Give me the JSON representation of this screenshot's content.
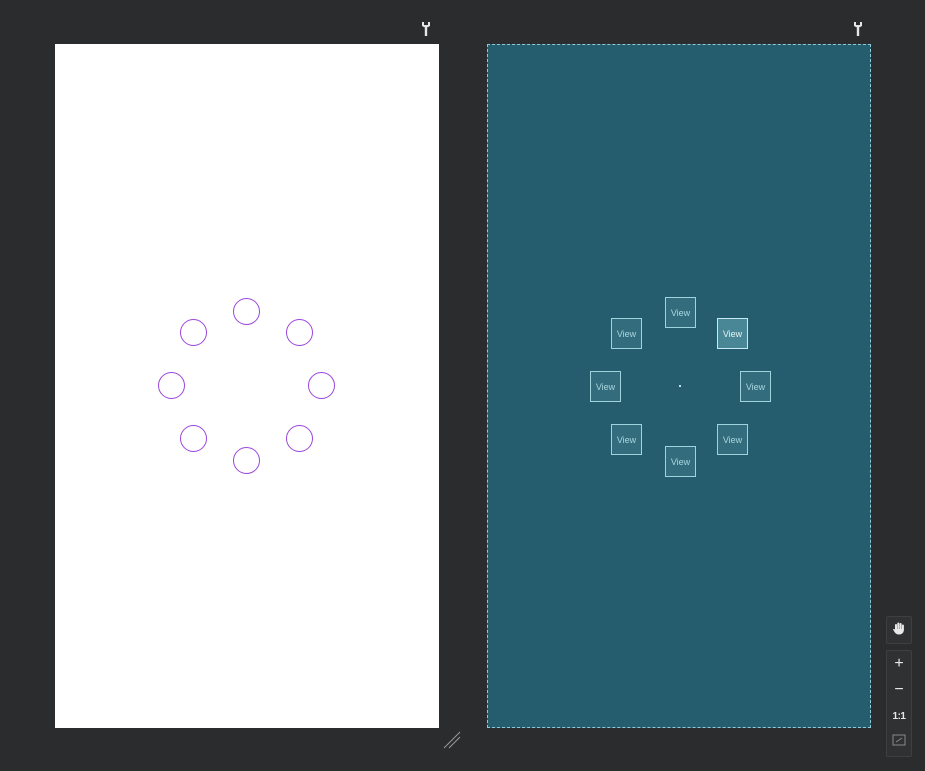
{
  "blueprint": {
    "view_label": "View",
    "views": [
      {
        "label": "View",
        "selected": false
      },
      {
        "label": "View",
        "selected": false
      },
      {
        "label": "View",
        "selected": true
      },
      {
        "label": "View",
        "selected": false
      },
      {
        "label": "View",
        "selected": false
      },
      {
        "label": "View",
        "selected": false
      },
      {
        "label": "View",
        "selected": false
      },
      {
        "label": "View",
        "selected": false
      }
    ]
  },
  "zoom": {
    "zoom_in_label": "+",
    "zoom_out_label": "−",
    "actual_size_label": "1:1"
  },
  "icons": {
    "design_configure": "wrench-icon",
    "blueprint_configure": "wrench-icon",
    "pan": "hand-icon",
    "fit": "fit-screen-icon",
    "resize": "resize-handle-icon"
  },
  "colors": {
    "canvas_background": "#2b2c2e",
    "design_background": "#ffffff",
    "circle_stroke": "#9b46dc",
    "blueprint_background": "#255c6e",
    "blueprint_border": "#8ec9d6"
  }
}
